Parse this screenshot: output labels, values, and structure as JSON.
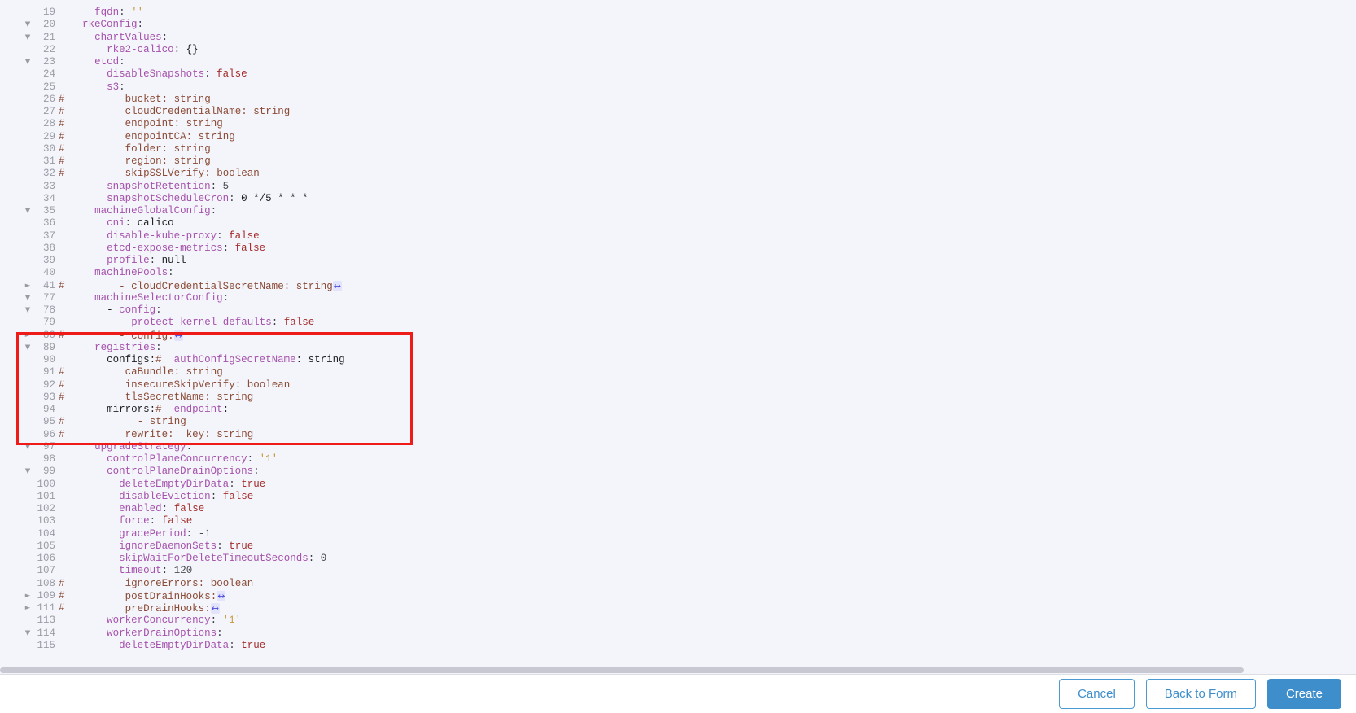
{
  "editor": {
    "language": "yaml",
    "background_color": "#f4f5fa",
    "gutter_text_color": "#9b9ba6",
    "fold_expanded_glyph": "▼",
    "fold_collapsed_glyph": "►",
    "widget_glyph": "↔",
    "lines": [
      {
        "num": "19",
        "fold": "",
        "hash": "",
        "indent": 4,
        "tokens": [
          {
            "t": "key",
            "v": "fqdn"
          },
          {
            "t": "punct",
            "v": ": "
          },
          {
            "t": "str",
            "v": "''"
          }
        ]
      },
      {
        "num": "20",
        "fold": "down",
        "hash": "",
        "indent": 2,
        "tokens": [
          {
            "t": "key",
            "v": "rkeConfig"
          },
          {
            "t": "punct",
            "v": ":"
          }
        ]
      },
      {
        "num": "21",
        "fold": "down",
        "hash": "",
        "indent": 4,
        "tokens": [
          {
            "t": "key",
            "v": "chartValues"
          },
          {
            "t": "punct",
            "v": ":"
          }
        ]
      },
      {
        "num": "22",
        "fold": "",
        "hash": "",
        "indent": 6,
        "tokens": [
          {
            "t": "key",
            "v": "rke2-calico"
          },
          {
            "t": "punct",
            "v": ": "
          },
          {
            "t": "plain",
            "v": "{}"
          }
        ]
      },
      {
        "num": "23",
        "fold": "down",
        "hash": "",
        "indent": 4,
        "tokens": [
          {
            "t": "key",
            "v": "etcd"
          },
          {
            "t": "punct",
            "v": ":"
          }
        ]
      },
      {
        "num": "24",
        "fold": "",
        "hash": "",
        "indent": 6,
        "tokens": [
          {
            "t": "key",
            "v": "disableSnapshots"
          },
          {
            "t": "punct",
            "v": ": "
          },
          {
            "t": "bool",
            "v": "false"
          }
        ]
      },
      {
        "num": "25",
        "fold": "",
        "hash": "",
        "indent": 6,
        "tokens": [
          {
            "t": "key",
            "v": "s3"
          },
          {
            "t": "punct",
            "v": ":"
          }
        ]
      },
      {
        "num": "26",
        "fold": "",
        "hash": "#",
        "indent": 9,
        "tokens": [
          {
            "t": "comment",
            "v": "bucket: string"
          }
        ]
      },
      {
        "num": "27",
        "fold": "",
        "hash": "#",
        "indent": 9,
        "tokens": [
          {
            "t": "comment",
            "v": "cloudCredentialName: string"
          }
        ]
      },
      {
        "num": "28",
        "fold": "",
        "hash": "#",
        "indent": 9,
        "tokens": [
          {
            "t": "comment",
            "v": "endpoint: string"
          }
        ]
      },
      {
        "num": "29",
        "fold": "",
        "hash": "#",
        "indent": 9,
        "tokens": [
          {
            "t": "comment",
            "v": "endpointCA: string"
          }
        ]
      },
      {
        "num": "30",
        "fold": "",
        "hash": "#",
        "indent": 9,
        "tokens": [
          {
            "t": "comment",
            "v": "folder: string"
          }
        ]
      },
      {
        "num": "31",
        "fold": "",
        "hash": "#",
        "indent": 9,
        "tokens": [
          {
            "t": "comment",
            "v": "region: string"
          }
        ]
      },
      {
        "num": "32",
        "fold": "",
        "hash": "#",
        "indent": 9,
        "tokens": [
          {
            "t": "comment",
            "v": "skipSSLVerify: boolean"
          }
        ]
      },
      {
        "num": "33",
        "fold": "",
        "hash": "",
        "indent": 6,
        "tokens": [
          {
            "t": "key",
            "v": "snapshotRetention"
          },
          {
            "t": "punct",
            "v": ": "
          },
          {
            "t": "num",
            "v": "5"
          }
        ]
      },
      {
        "num": "34",
        "fold": "",
        "hash": "",
        "indent": 6,
        "tokens": [
          {
            "t": "key",
            "v": "snapshotScheduleCron"
          },
          {
            "t": "punct",
            "v": ": "
          },
          {
            "t": "plain",
            "v": "0 */5 * * *"
          }
        ]
      },
      {
        "num": "35",
        "fold": "down",
        "hash": "",
        "indent": 4,
        "tokens": [
          {
            "t": "key",
            "v": "machineGlobalConfig"
          },
          {
            "t": "punct",
            "v": ":"
          }
        ]
      },
      {
        "num": "36",
        "fold": "",
        "hash": "",
        "indent": 6,
        "tokens": [
          {
            "t": "key",
            "v": "cni"
          },
          {
            "t": "punct",
            "v": ": "
          },
          {
            "t": "plain",
            "v": "calico"
          }
        ]
      },
      {
        "num": "37",
        "fold": "",
        "hash": "",
        "indent": 6,
        "tokens": [
          {
            "t": "key",
            "v": "disable-kube-proxy"
          },
          {
            "t": "punct",
            "v": ": "
          },
          {
            "t": "bool",
            "v": "false"
          }
        ]
      },
      {
        "num": "38",
        "fold": "",
        "hash": "",
        "indent": 6,
        "tokens": [
          {
            "t": "key",
            "v": "etcd-expose-metrics"
          },
          {
            "t": "punct",
            "v": ": "
          },
          {
            "t": "bool",
            "v": "false"
          }
        ]
      },
      {
        "num": "39",
        "fold": "",
        "hash": "",
        "indent": 6,
        "tokens": [
          {
            "t": "key",
            "v": "profile"
          },
          {
            "t": "punct",
            "v": ": "
          },
          {
            "t": "plain",
            "v": "null"
          }
        ]
      },
      {
        "num": "40",
        "fold": "",
        "hash": "",
        "indent": 4,
        "tokens": [
          {
            "t": "key",
            "v": "machinePools"
          },
          {
            "t": "punct",
            "v": ":"
          }
        ]
      },
      {
        "num": "41",
        "fold": "right",
        "hash": "#",
        "indent": 8,
        "tokens": [
          {
            "t": "comment",
            "v": "- cloudCredentialSecretName: string"
          },
          {
            "t": "widget",
            "v": "↔"
          }
        ]
      },
      {
        "num": "77",
        "fold": "down",
        "hash": "",
        "indent": 4,
        "tokens": [
          {
            "t": "key",
            "v": "machineSelectorConfig"
          },
          {
            "t": "punct",
            "v": ":"
          }
        ]
      },
      {
        "num": "78",
        "fold": "down",
        "hash": "",
        "indent": 6,
        "tokens": [
          {
            "t": "plain",
            "v": "- "
          },
          {
            "t": "key",
            "v": "config"
          },
          {
            "t": "punct",
            "v": ":"
          }
        ]
      },
      {
        "num": "79",
        "fold": "",
        "hash": "",
        "indent": 10,
        "tokens": [
          {
            "t": "key",
            "v": "protect-kernel-defaults"
          },
          {
            "t": "punct",
            "v": ": "
          },
          {
            "t": "bool",
            "v": "false"
          }
        ]
      },
      {
        "num": "80",
        "fold": "right",
        "hash": "#",
        "indent": 8,
        "tokens": [
          {
            "t": "comment",
            "v": "- config:"
          },
          {
            "t": "widget",
            "v": "↔"
          }
        ]
      },
      {
        "num": "89",
        "fold": "down",
        "hash": "",
        "indent": 4,
        "tokens": [
          {
            "t": "key",
            "v": "registries"
          },
          {
            "t": "punct",
            "v": ":"
          }
        ]
      },
      {
        "num": "90",
        "fold": "",
        "hash": "",
        "indent": 6,
        "tokens": [
          {
            "t": "plain",
            "v": "configs:"
          },
          {
            "t": "comment",
            "v": "#  "
          },
          {
            "t": "comment-key",
            "v": "authConfigSecretName"
          },
          {
            "t": "plain",
            "v": ": string"
          }
        ]
      },
      {
        "num": "91",
        "fold": "",
        "hash": "#",
        "indent": 9,
        "tokens": [
          {
            "t": "comment",
            "v": "caBundle: string"
          }
        ]
      },
      {
        "num": "92",
        "fold": "",
        "hash": "#",
        "indent": 9,
        "tokens": [
          {
            "t": "comment",
            "v": "insecureSkipVerify: boolean"
          }
        ]
      },
      {
        "num": "93",
        "fold": "",
        "hash": "#",
        "indent": 9,
        "tokens": [
          {
            "t": "comment",
            "v": "tlsSecretName: string"
          }
        ]
      },
      {
        "num": "94",
        "fold": "",
        "hash": "",
        "indent": 6,
        "tokens": [
          {
            "t": "plain",
            "v": "mirrors:"
          },
          {
            "t": "comment",
            "v": "#  "
          },
          {
            "t": "comment-key",
            "v": "endpoint"
          },
          {
            "t": "plain",
            "v": ":"
          }
        ]
      },
      {
        "num": "95",
        "fold": "",
        "hash": "#",
        "indent": 11,
        "tokens": [
          {
            "t": "comment",
            "v": "- string"
          }
        ]
      },
      {
        "num": "96",
        "fold": "",
        "hash": "#",
        "indent": 9,
        "tokens": [
          {
            "t": "comment",
            "v": "rewrite:  key: string"
          }
        ]
      },
      {
        "num": "97",
        "fold": "down",
        "hash": "",
        "indent": 4,
        "tokens": [
          {
            "t": "key",
            "v": "upgradeStrategy"
          },
          {
            "t": "punct",
            "v": ":"
          }
        ]
      },
      {
        "num": "98",
        "fold": "",
        "hash": "",
        "indent": 6,
        "tokens": [
          {
            "t": "key",
            "v": "controlPlaneConcurrency"
          },
          {
            "t": "punct",
            "v": ": "
          },
          {
            "t": "str",
            "v": "'1'"
          }
        ]
      },
      {
        "num": "99",
        "fold": "down",
        "hash": "",
        "indent": 6,
        "tokens": [
          {
            "t": "key",
            "v": "controlPlaneDrainOptions"
          },
          {
            "t": "punct",
            "v": ":"
          }
        ]
      },
      {
        "num": "100",
        "fold": "",
        "hash": "",
        "indent": 8,
        "tokens": [
          {
            "t": "key",
            "v": "deleteEmptyDirData"
          },
          {
            "t": "punct",
            "v": ": "
          },
          {
            "t": "bool",
            "v": "true"
          }
        ]
      },
      {
        "num": "101",
        "fold": "",
        "hash": "",
        "indent": 8,
        "tokens": [
          {
            "t": "key",
            "v": "disableEviction"
          },
          {
            "t": "punct",
            "v": ": "
          },
          {
            "t": "bool",
            "v": "false"
          }
        ]
      },
      {
        "num": "102",
        "fold": "",
        "hash": "",
        "indent": 8,
        "tokens": [
          {
            "t": "key",
            "v": "enabled"
          },
          {
            "t": "punct",
            "v": ": "
          },
          {
            "t": "bool",
            "v": "false"
          }
        ]
      },
      {
        "num": "103",
        "fold": "",
        "hash": "",
        "indent": 8,
        "tokens": [
          {
            "t": "key",
            "v": "force"
          },
          {
            "t": "punct",
            "v": ": "
          },
          {
            "t": "bool",
            "v": "false"
          }
        ]
      },
      {
        "num": "104",
        "fold": "",
        "hash": "",
        "indent": 8,
        "tokens": [
          {
            "t": "key",
            "v": "gracePeriod"
          },
          {
            "t": "punct",
            "v": ": "
          },
          {
            "t": "num",
            "v": "-1"
          }
        ]
      },
      {
        "num": "105",
        "fold": "",
        "hash": "",
        "indent": 8,
        "tokens": [
          {
            "t": "key",
            "v": "ignoreDaemonSets"
          },
          {
            "t": "punct",
            "v": ": "
          },
          {
            "t": "bool",
            "v": "true"
          }
        ]
      },
      {
        "num": "106",
        "fold": "",
        "hash": "",
        "indent": 8,
        "tokens": [
          {
            "t": "key",
            "v": "skipWaitForDeleteTimeoutSeconds"
          },
          {
            "t": "punct",
            "v": ": "
          },
          {
            "t": "num",
            "v": "0"
          }
        ]
      },
      {
        "num": "107",
        "fold": "",
        "hash": "",
        "indent": 8,
        "tokens": [
          {
            "t": "key",
            "v": "timeout"
          },
          {
            "t": "punct",
            "v": ": "
          },
          {
            "t": "num",
            "v": "120"
          }
        ]
      },
      {
        "num": "108",
        "fold": "",
        "hash": "#",
        "indent": 9,
        "tokens": [
          {
            "t": "comment",
            "v": "ignoreErrors: boolean"
          }
        ]
      },
      {
        "num": "109",
        "fold": "right",
        "hash": "#",
        "indent": 9,
        "tokens": [
          {
            "t": "comment",
            "v": "postDrainHooks:"
          },
          {
            "t": "widget",
            "v": "↔"
          }
        ]
      },
      {
        "num": "111",
        "fold": "right",
        "hash": "#",
        "indent": 9,
        "tokens": [
          {
            "t": "comment",
            "v": "preDrainHooks:"
          },
          {
            "t": "widget",
            "v": "↔"
          }
        ]
      },
      {
        "num": "113",
        "fold": "",
        "hash": "",
        "indent": 6,
        "tokens": [
          {
            "t": "key",
            "v": "workerConcurrency"
          },
          {
            "t": "punct",
            "v": ": "
          },
          {
            "t": "str",
            "v": "'1'"
          }
        ]
      },
      {
        "num": "114",
        "fold": "down",
        "hash": "",
        "indent": 6,
        "tokens": [
          {
            "t": "key",
            "v": "workerDrainOptions"
          },
          {
            "t": "punct",
            "v": ":"
          }
        ]
      },
      {
        "num": "115",
        "fold": "",
        "hash": "",
        "indent": 8,
        "tokens": [
          {
            "t": "key",
            "v": "deleteEmptyDirData"
          },
          {
            "t": "punct",
            "v": ": "
          },
          {
            "t": "bool",
            "v": "true"
          }
        ]
      }
    ]
  },
  "annotation": {
    "label": "highlight-rectangle",
    "color": "#ef1b18",
    "covers_lines": "89-97"
  },
  "footer": {
    "cancel_label": "Cancel",
    "back_to_form_label": "Back to Form",
    "create_label": "Create",
    "accent_color": "#3d8ecb"
  }
}
